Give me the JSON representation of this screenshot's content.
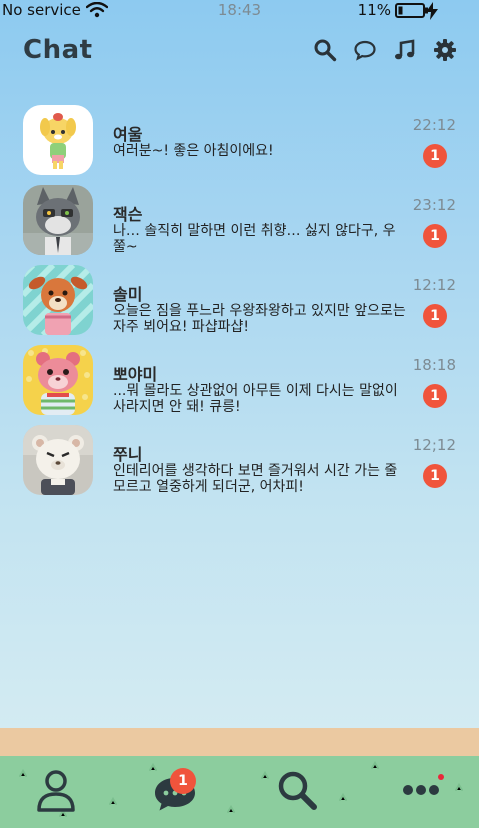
{
  "status_bar": {
    "carrier": "No service",
    "time": "18:43",
    "battery": "11%"
  },
  "header": {
    "title": "Chat",
    "icons": [
      "search-icon",
      "chat-bubble-icon",
      "music-note-icon",
      "gear-icon"
    ]
  },
  "chats": [
    {
      "name": "여울",
      "message": "여러분~! 좋은 아침이에요!",
      "time": "22:12",
      "unread": "1",
      "avatar": "isabelle-avatar"
    },
    {
      "name": "잭슨",
      "message": "나… 솔직히 말하면 이런 취향… 싫지 않다구, 우쭐~",
      "time": "23:12",
      "unread": "1",
      "avatar": "raymond-avatar"
    },
    {
      "name": "솔미",
      "message": "오늘은 짐을 푸느라 우왕좌왕하고 있지만 앞으로는 자주 뵈어요! 파샵파샵!",
      "time": "12:12",
      "unread": "1",
      "avatar": "deer-avatar"
    },
    {
      "name": "뽀야미",
      "message": "...뭐 몰라도 상관없어 아무튼 이제 다시는 말없이 사라지면 안 돼! 큐릉!",
      "time": "18:18",
      "unread": "1",
      "avatar": "hamster-avatar"
    },
    {
      "name": "쭈니",
      "message": "인테리어를 생각하다 보면 즐거워서 시간 가는 줄 모르고 열중하게 되더군, 어차피!",
      "time": "12;12",
      "unread": "1",
      "avatar": "marshal-avatar"
    }
  ],
  "bottom_nav": {
    "items": [
      "profile-icon",
      "chat-icon",
      "search-icon",
      "more-icon"
    ],
    "chat_badge": "1"
  },
  "colors": {
    "accent_badge": "#f0543c",
    "sand": "#ebc9a1",
    "grass": "#8ccd9e",
    "nav_icon": "#2c3a40"
  }
}
